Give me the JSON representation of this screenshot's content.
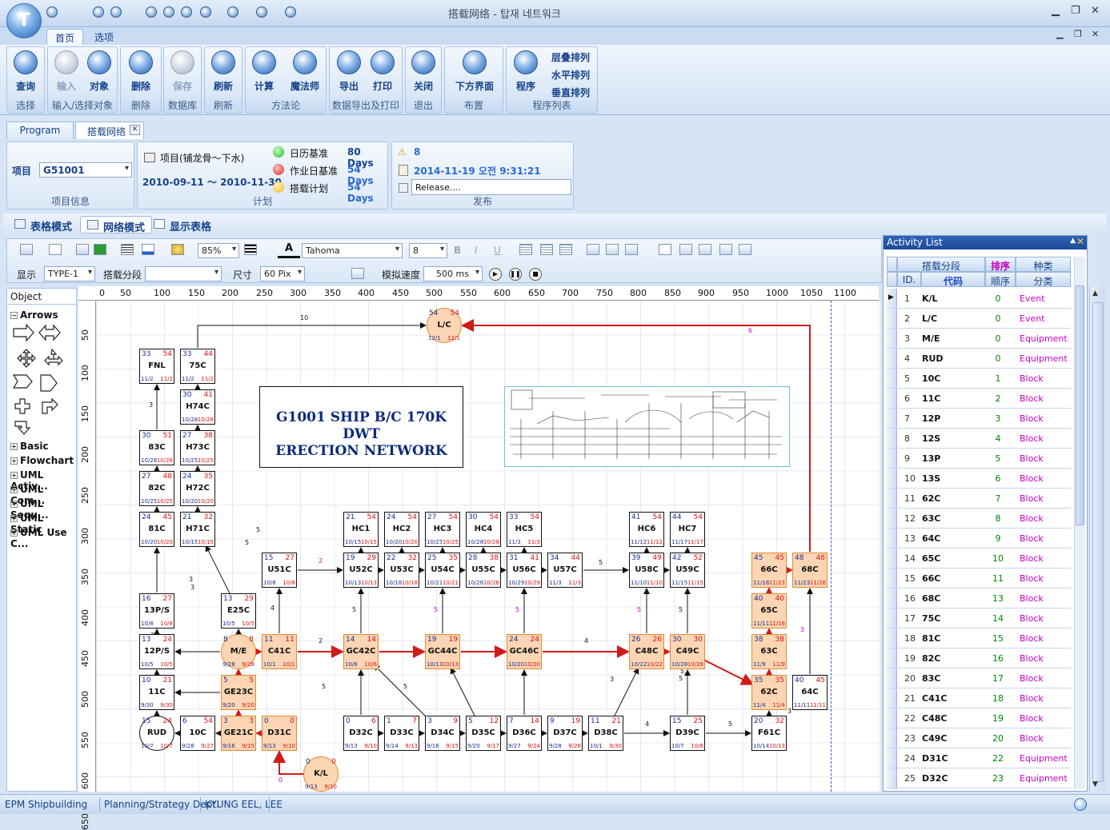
{
  "window": {
    "title": "搭载网络 - 탑재 네트워크"
  },
  "ribbon_tabs": [
    "首页",
    "选项"
  ],
  "ribbon": {
    "groups": [
      {
        "label": "选择",
        "buttons": [
          "查询"
        ]
      },
      {
        "label": "输入/选择对象",
        "buttons": [
          "输入",
          "对象"
        ]
      },
      {
        "label": "删除",
        "buttons": [
          "删除"
        ]
      },
      {
        "label": "数据库",
        "buttons": [
          "保存"
        ]
      },
      {
        "label": "刷新",
        "buttons": [
          "刷新"
        ]
      },
      {
        "label": "方法论",
        "buttons": [
          "计算",
          "魔法师"
        ]
      },
      {
        "label": "数据导出及打印",
        "buttons": [
          "导出",
          "打印"
        ]
      },
      {
        "label": "退出",
        "buttons": [
          "关闭"
        ]
      },
      {
        "label": "布置",
        "buttons": [
          "下方界面"
        ]
      },
      {
        "label": "程序列表",
        "buttons": [
          "程序"
        ]
      }
    ],
    "arrange": [
      "层叠排列",
      "水平排列",
      "垂直排列"
    ]
  },
  "doc_tabs": [
    "Program",
    "搭载网络"
  ],
  "info": {
    "project_label": "项目",
    "project_value": "G51001",
    "project_group": "项目信息",
    "plan_name": "项目(铺龙骨～下水)",
    "plan_range": "2010-09-11 ～ 2010-11-30",
    "plan_group": "计划",
    "baselines": [
      {
        "label": "日历基准",
        "days": "80 Days",
        "color": "#2db52d"
      },
      {
        "label": "作业日基准",
        "days": "54 Days",
        "color": "#d92b2b"
      },
      {
        "label": "搭载计划",
        "days": "54 Days",
        "color": "#f2b71d"
      }
    ],
    "release_count": "8",
    "release_time": "2014-11-19 오전 9:31:21",
    "release_text": "Release....",
    "release_group": "发布"
  },
  "modes": [
    "表格模式",
    "网络模式",
    "显示表格"
  ],
  "toolbar": {
    "zoom": "85%",
    "font": "Tahoma",
    "font_size": "8",
    "display_label": "显示",
    "display_value": "TYPE-1",
    "segment_label": "搭载分段",
    "size_label": "尺寸",
    "size_value": "60 Pix",
    "speed_label": "模拟速度",
    "speed_value": "500 ms"
  },
  "left_panel": {
    "header": "Object",
    "sections": [
      "Arrows",
      "Basic",
      "Flowchart",
      "UML Activ...",
      "UML Com...",
      "UML Sequ...",
      "UML Static",
      "UML Use C..."
    ]
  },
  "ruler_top": [
    "0",
    "50",
    "100",
    "150",
    "200",
    "250",
    "300",
    "350",
    "400",
    "450",
    "500",
    "550",
    "600",
    "650",
    "700",
    "750",
    "800",
    "850",
    "900",
    "950",
    "1000",
    "1050",
    "1100"
  ],
  "ruler_left": [
    "50",
    "100",
    "150",
    "200",
    "250",
    "300",
    "350",
    "400",
    "450",
    "500",
    "550",
    "600",
    "650"
  ],
  "banner": {
    "line1": "G1001 SHIP B/C 170K DWT",
    "line2": "ERECTION NETWORK"
  },
  "network": {
    "nodes": [
      {
        "name": "L/C",
        "es": "54",
        "lf": "54",
        "sd": "12/1",
        "fd": "12/1",
        "style": "orange-circle"
      },
      {
        "name": "FNL",
        "es": "33",
        "lf": "54",
        "sd": "11/2",
        "fd": "11/2",
        "style": "plain"
      },
      {
        "name": "75C",
        "es": "33",
        "lf": "44",
        "sd": "11/2",
        "fd": "11/2",
        "style": "plain"
      },
      {
        "name": "H74C",
        "es": "30",
        "lf": "41",
        "sd": "10/28",
        "fd": "10/28",
        "style": "plain"
      },
      {
        "name": "83C",
        "es": "30",
        "lf": "51",
        "sd": "10/28",
        "fd": "10/28",
        "style": "plain"
      },
      {
        "name": "H73C",
        "es": "27",
        "lf": "38",
        "sd": "10/25",
        "fd": "10/25",
        "style": "plain"
      },
      {
        "name": "82C",
        "es": "27",
        "lf": "48",
        "sd": "10/25",
        "fd": "10/25",
        "style": "plain"
      },
      {
        "name": "H72C",
        "es": "24",
        "lf": "35",
        "sd": "10/20",
        "fd": "10/20",
        "style": "plain"
      },
      {
        "name": "81C",
        "es": "24",
        "lf": "45",
        "sd": "10/20",
        "fd": "10/20",
        "style": "plain"
      },
      {
        "name": "H71C",
        "es": "21",
        "lf": "32",
        "sd": "10/15",
        "fd": "10/15",
        "style": "plain"
      },
      {
        "name": "HC1",
        "es": "21",
        "lf": "54",
        "sd": "10/15",
        "fd": "10/15",
        "style": "plain"
      },
      {
        "name": "HC2",
        "es": "24",
        "lf": "54",
        "sd": "10/20",
        "fd": "10/20",
        "style": "plain"
      },
      {
        "name": "HC3",
        "es": "27",
        "lf": "54",
        "sd": "10/25",
        "fd": "10/25",
        "style": "plain"
      },
      {
        "name": "HC4",
        "es": "30",
        "lf": "54",
        "sd": "10/28",
        "fd": "10/28",
        "style": "plain"
      },
      {
        "name": "HC5",
        "es": "33",
        "lf": "54",
        "sd": "11/3",
        "fd": "11/3",
        "style": "plain"
      },
      {
        "name": "HC6",
        "es": "41",
        "lf": "54",
        "sd": "11/12",
        "fd": "11/12",
        "style": "plain"
      },
      {
        "name": "HC7",
        "es": "44",
        "lf": "54",
        "sd": "11/17",
        "fd": "11/17",
        "style": "plain"
      },
      {
        "name": "U51C",
        "es": "15",
        "lf": "27",
        "sd": "10/8",
        "fd": "10/8",
        "style": "plain"
      },
      {
        "name": "U52C",
        "es": "19",
        "lf": "29",
        "sd": "10/13",
        "fd": "10/13",
        "style": "plain"
      },
      {
        "name": "U53C",
        "es": "22",
        "lf": "32",
        "sd": "10/18",
        "fd": "10/18",
        "style": "plain"
      },
      {
        "name": "U54C",
        "es": "25",
        "lf": "35",
        "sd": "10/21",
        "fd": "10/21",
        "style": "plain"
      },
      {
        "name": "U55C",
        "es": "28",
        "lf": "38",
        "sd": "10/26",
        "fd": "10/26",
        "style": "plain"
      },
      {
        "name": "U56C",
        "es": "31",
        "lf": "41",
        "sd": "10/29",
        "fd": "10/29",
        "style": "plain"
      },
      {
        "name": "U57C",
        "es": "34",
        "lf": "44",
        "sd": "11/3",
        "fd": "11/3",
        "style": "plain"
      },
      {
        "name": "U58C",
        "es": "39",
        "lf": "49",
        "sd": "11/10",
        "fd": "11/10",
        "style": "plain"
      },
      {
        "name": "U59C",
        "es": "42",
        "lf": "52",
        "sd": "11/15",
        "fd": "11/15",
        "style": "plain"
      },
      {
        "name": "66C",
        "es": "45",
        "lf": "45",
        "sd": "11/18",
        "fd": "11/23",
        "style": "orange"
      },
      {
        "name": "68C",
        "es": "48",
        "lf": "48",
        "sd": "11/23",
        "fd": "11/26",
        "style": "orange"
      },
      {
        "name": "13P/S",
        "es": "16",
        "lf": "27",
        "sd": "10/8",
        "fd": "10/8",
        "style": "plain"
      },
      {
        "name": "E25C",
        "es": "13",
        "lf": "29",
        "sd": "10/5",
        "fd": "10/5",
        "style": "plain"
      },
      {
        "name": "65C",
        "es": "40",
        "lf": "40",
        "sd": "11/11",
        "fd": "11/16",
        "style": "orange"
      },
      {
        "name": "12P/S",
        "es": "13",
        "lf": "24",
        "sd": "10/5",
        "fd": "10/5",
        "style": "plain"
      },
      {
        "name": "M/E",
        "es": "8",
        "lf": "8",
        "sd": "9/28",
        "fd": "9/28",
        "style": "orange-circle"
      },
      {
        "name": "C41C",
        "es": "11",
        "lf": "11",
        "sd": "10/1",
        "fd": "10/1",
        "style": "orange"
      },
      {
        "name": "GC42C",
        "es": "14",
        "lf": "14",
        "sd": "10/6",
        "fd": "10/6",
        "style": "orange"
      },
      {
        "name": "GC44C",
        "es": "19",
        "lf": "19",
        "sd": "10/13",
        "fd": "10/13",
        "style": "orange"
      },
      {
        "name": "GC46C",
        "es": "24",
        "lf": "24",
        "sd": "10/20",
        "fd": "10/20",
        "style": "orange"
      },
      {
        "name": "C48C",
        "es": "26",
        "lf": "26",
        "sd": "10/22",
        "fd": "10/22",
        "style": "orange"
      },
      {
        "name": "C49C",
        "es": "30",
        "lf": "30",
        "sd": "10/28",
        "fd": "10/28",
        "style": "orange"
      },
      {
        "name": "63C",
        "es": "38",
        "lf": "38",
        "sd": "11/9",
        "fd": "11/9",
        "style": "orange"
      },
      {
        "name": "11C",
        "es": "10",
        "lf": "21",
        "sd": "9/30",
        "fd": "9/30",
        "style": "plain"
      },
      {
        "name": "GE23C",
        "es": "5",
        "lf": "5",
        "sd": "9/20",
        "fd": "9/20",
        "style": "orange"
      },
      {
        "name": "62C",
        "es": "35",
        "lf": "35",
        "sd": "11/4",
        "fd": "11/4",
        "style": "orange"
      },
      {
        "name": "64C",
        "es": "40",
        "lf": "45",
        "sd": "11/11",
        "fd": "11/11",
        "style": "plain"
      },
      {
        "name": "RUD",
        "es": "15",
        "lf": "24",
        "sd": "10/7",
        "fd": "10/7",
        "style": "circle"
      },
      {
        "name": "10C",
        "es": "6",
        "lf": "54",
        "sd": "9/28",
        "fd": "9/27",
        "style": "plain"
      },
      {
        "name": "GE21C",
        "es": "3",
        "lf": "3",
        "sd": "9/16",
        "fd": "9/15",
        "style": "orange"
      },
      {
        "name": "D31C",
        "es": "0",
        "lf": "0",
        "sd": "9/13",
        "fd": "9/10",
        "style": "orange"
      },
      {
        "name": "D32C",
        "es": "0",
        "lf": "6",
        "sd": "9/13",
        "fd": "9/10",
        "style": "plain"
      },
      {
        "name": "D33C",
        "es": "1",
        "lf": "7",
        "sd": "9/14",
        "fd": "9/13",
        "style": "plain"
      },
      {
        "name": "D34C",
        "es": "3",
        "lf": "9",
        "sd": "9/16",
        "fd": "9/15",
        "style": "plain"
      },
      {
        "name": "D35C",
        "es": "5",
        "lf": "12",
        "sd": "9/20",
        "fd": "9/17",
        "style": "plain"
      },
      {
        "name": "D36C",
        "es": "7",
        "lf": "14",
        "sd": "9/27",
        "fd": "9/24",
        "style": "plain"
      },
      {
        "name": "D37C",
        "es": "9",
        "lf": "19",
        "sd": "9/28",
        "fd": "9/28",
        "style": "plain"
      },
      {
        "name": "D38C",
        "es": "11",
        "lf": "21",
        "sd": "10/1",
        "fd": "9/30",
        "style": "plain"
      },
      {
        "name": "D39C",
        "es": "15",
        "lf": "25",
        "sd": "10/7",
        "fd": "10/6",
        "style": "plain"
      },
      {
        "name": "F61C",
        "es": "20",
        "lf": "32",
        "sd": "10/14",
        "fd": "10/13",
        "style": "plain"
      },
      {
        "name": "K/L",
        "es": "0",
        "lf": "0",
        "sd": "9/13",
        "fd": "9/10",
        "style": "orange-circle"
      }
    ],
    "edge_labels": [
      "10",
      "6",
      "3",
      "5",
      "3",
      "3",
      "5",
      "2",
      "4",
      "5",
      "5",
      "5",
      "5",
      "5",
      "5",
      "3",
      "5",
      "3",
      "2",
      "4",
      "5",
      "5",
      "3",
      "3",
      "5",
      "4",
      "5",
      "5",
      "0",
      "3"
    ]
  },
  "activity_list": {
    "title": "Activity List",
    "headers_row1": [
      "搭载分段",
      "排序",
      "种类"
    ],
    "headers_row2": [
      "ID.",
      "代码",
      "顺序",
      "分类"
    ],
    "rows": [
      {
        "id": "1",
        "code": "K/L",
        "seq": "0",
        "type": "Event"
      },
      {
        "id": "2",
        "code": "L/C",
        "seq": "0",
        "type": "Event"
      },
      {
        "id": "3",
        "code": "M/E",
        "seq": "0",
        "type": "Equipment"
      },
      {
        "id": "4",
        "code": "RUD",
        "seq": "0",
        "type": "Equipment"
      },
      {
        "id": "5",
        "code": "10C",
        "seq": "1",
        "type": "Block"
      },
      {
        "id": "6",
        "code": "11C",
        "seq": "2",
        "type": "Block"
      },
      {
        "id": "7",
        "code": "12P",
        "seq": "3",
        "type": "Block"
      },
      {
        "id": "8",
        "code": "12S",
        "seq": "4",
        "type": "Block"
      },
      {
        "id": "9",
        "code": "13P",
        "seq": "5",
        "type": "Block"
      },
      {
        "id": "10",
        "code": "13S",
        "seq": "6",
        "type": "Block"
      },
      {
        "id": "11",
        "code": "62C",
        "seq": "7",
        "type": "Block"
      },
      {
        "id": "12",
        "code": "63C",
        "seq": "8",
        "type": "Block"
      },
      {
        "id": "13",
        "code": "64C",
        "seq": "9",
        "type": "Block"
      },
      {
        "id": "14",
        "code": "65C",
        "seq": "10",
        "type": "Block"
      },
      {
        "id": "15",
        "code": "66C",
        "seq": "11",
        "type": "Block"
      },
      {
        "id": "16",
        "code": "68C",
        "seq": "13",
        "type": "Block"
      },
      {
        "id": "17",
        "code": "75C",
        "seq": "14",
        "type": "Block"
      },
      {
        "id": "18",
        "code": "81C",
        "seq": "15",
        "type": "Block"
      },
      {
        "id": "19",
        "code": "82C",
        "seq": "16",
        "type": "Block"
      },
      {
        "id": "20",
        "code": "83C",
        "seq": "17",
        "type": "Block"
      },
      {
        "id": "21",
        "code": "C41C",
        "seq": "18",
        "type": "Block"
      },
      {
        "id": "22",
        "code": "C48C",
        "seq": "19",
        "type": "Block"
      },
      {
        "id": "23",
        "code": "C49C",
        "seq": "20",
        "type": "Block"
      },
      {
        "id": "24",
        "code": "D31C",
        "seq": "22",
        "type": "Equipment"
      },
      {
        "id": "25",
        "code": "D32C",
        "seq": "23",
        "type": "Equipment"
      }
    ]
  },
  "status": {
    "company": "EPM Shipbuilding",
    "dept": "Planning/Strategy Dept.",
    "user": "KYUNG EEL, LEE"
  },
  "colors": {
    "critical": "#d11a1a",
    "critical_fill": "#fcd5b4",
    "event": "#cc00cc",
    "seq": "#008800"
  }
}
